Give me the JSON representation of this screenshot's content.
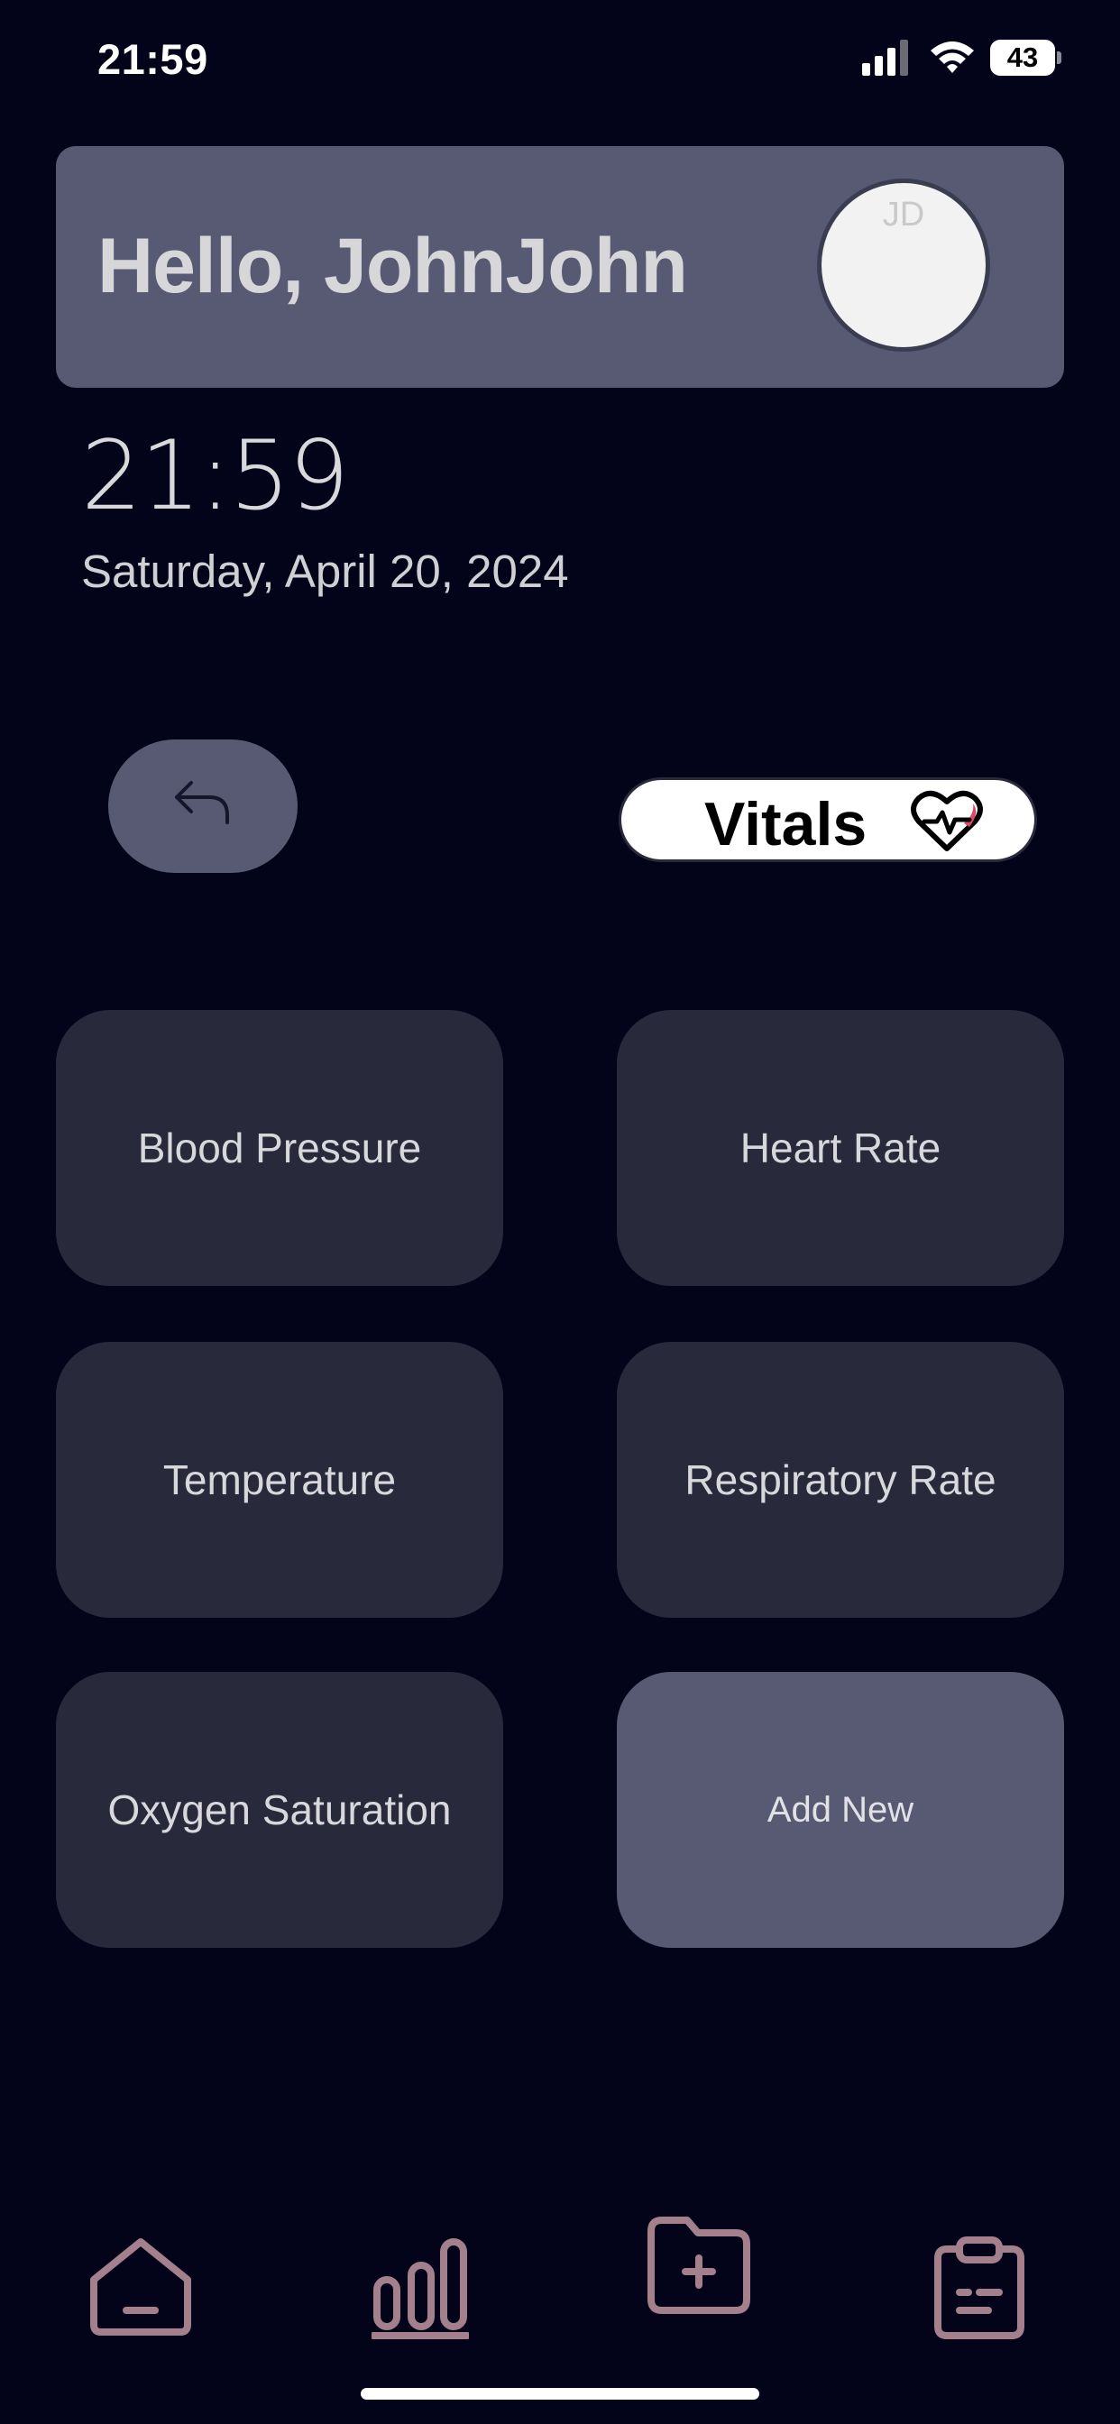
{
  "status_bar": {
    "time": "21:59",
    "battery": "43",
    "icons": [
      "signal-icon",
      "wifi-icon",
      "battery-icon"
    ]
  },
  "header": {
    "greeting": "Hello, JohnJohn",
    "avatar_initials": "JD"
  },
  "clock": {
    "time": "21:59",
    "date": "Saturday, April 20, 2024"
  },
  "controls": {
    "back_icon": "reply-arrow-icon",
    "section_label": "Vitals",
    "section_icon": "heart-pulse-icon"
  },
  "tiles": [
    {
      "label": "Blood Pressure"
    },
    {
      "label": "Heart Rate"
    },
    {
      "label": "Temperature"
    },
    {
      "label": "Respiratory Rate"
    },
    {
      "label": "Oxygen Saturation"
    },
    {
      "label": "Add New"
    }
  ],
  "bottom_nav": {
    "items": [
      "home-icon",
      "stats-icon",
      "folder-add-icon",
      "clipboard-icon"
    ],
    "icon_color": "#a4808c"
  },
  "colors": {
    "background": "#03041a",
    "card": "#585a74",
    "tile": "#282a3c",
    "accent_heart": "#e0456a"
  }
}
